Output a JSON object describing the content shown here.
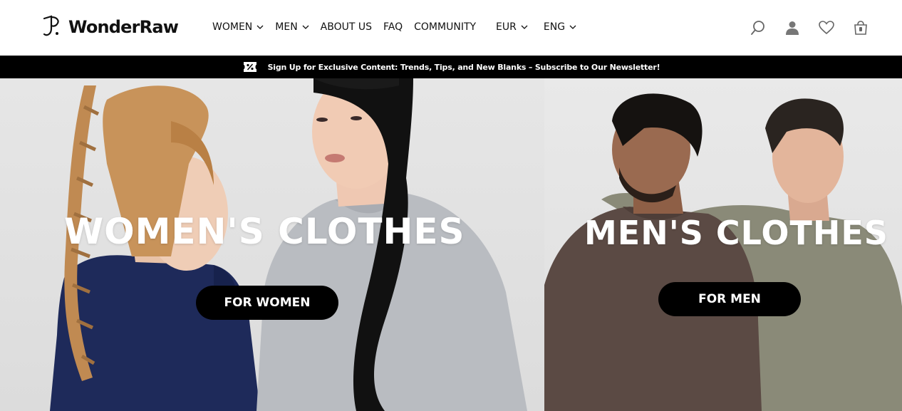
{
  "brand": {
    "name": "WonderRaw"
  },
  "nav": {
    "items": [
      {
        "label": "WOMEN",
        "has_dropdown": true
      },
      {
        "label": "MEN",
        "has_dropdown": true
      },
      {
        "label": "ABOUT US",
        "has_dropdown": false
      },
      {
        "label": "FAQ",
        "has_dropdown": false
      },
      {
        "label": "COMMUNITY",
        "has_dropdown": false
      }
    ],
    "currency": "EUR",
    "language": "ENG"
  },
  "header_icons": [
    "search-icon",
    "account-icon",
    "wishlist-heart-icon",
    "cart-bag-icon"
  ],
  "announcement": {
    "text": "Sign Up for Exclusive Content: Trends, Tips, and New Blanks – Subscribe to Our Newsletter!",
    "icon": "discount-tag-icon"
  },
  "hero": {
    "women": {
      "title": "WOMEN'S CLOTHES",
      "button": "FOR WOMEN"
    },
    "men": {
      "title": "MEN'S CLOTHES",
      "button": "FOR MEN"
    }
  },
  "colors": {
    "announcement_bg": "#000000",
    "button_bg": "#000000",
    "button_text": "#ffffff",
    "hero_title": "#ffffff",
    "navy_shirt": "#1e2a5a",
    "grey_sweatshirt": "#b9bcc1",
    "brown_sweatshirt": "#5b4a44",
    "olive_sweatshirt": "#8a8a78"
  }
}
